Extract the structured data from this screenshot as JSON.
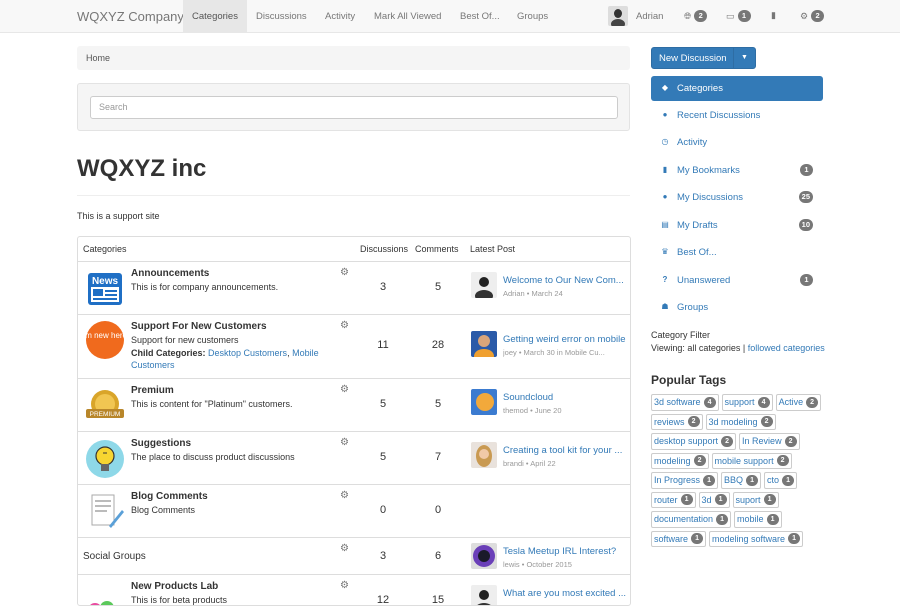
{
  "brand": "WQXYZ Company",
  "nav": [
    "Categories",
    "Discussions",
    "Activity",
    "Mark All Viewed",
    "Best Of...",
    "Groups"
  ],
  "user": {
    "name": "Adrian"
  },
  "top_icons": [
    {
      "icon": "globe-icon",
      "badge": "2"
    },
    {
      "icon": "inbox-icon",
      "badge": "1"
    },
    {
      "icon": "bookmark-icon",
      "badge": ""
    },
    {
      "icon": "gear-icon",
      "badge": "2"
    }
  ],
  "breadcrumb": "Home",
  "search": {
    "placeholder": "Search"
  },
  "page_title": "WQXYZ inc",
  "page_desc": "This is a support site",
  "table_headers": {
    "categories": "Categories",
    "discussions": "Discussions",
    "comments": "Comments",
    "latest": "Latest Post"
  },
  "rows": [
    {
      "name": "Announcements",
      "desc": "This is for company announcements.",
      "discussions": "3",
      "comments": "5",
      "latest_title": "Welcome to Our New Com...",
      "latest_meta": "Adrian • March 24"
    },
    {
      "name": "Support For New Customers",
      "desc": "Support for new customers",
      "child_label": "Child Categories:",
      "child1": "Desktop Customers",
      "child2": "Mobile Customers",
      "discussions": "11",
      "comments": "28",
      "latest_title": "Getting weird error on mobile",
      "latest_meta": "joey • March 30 in Mobile Cu..."
    },
    {
      "name": "Premium",
      "desc": "This is content for \"Platinum\" customers.",
      "discussions": "5",
      "comments": "5",
      "latest_title": "Soundcloud",
      "latest_meta": "themod • June 20"
    },
    {
      "name": "Suggestions",
      "desc": "The place to discuss product discussions",
      "discussions": "5",
      "comments": "7",
      "latest_title": "Creating a tool kit for your ...",
      "latest_meta": "brandi • April 22"
    },
    {
      "name": "Blog Comments",
      "desc": "Blog Comments",
      "discussions": "0",
      "comments": "0"
    },
    {
      "name": "Social Groups",
      "discussions": "3",
      "comments": "6",
      "latest_title": "Tesla Meetup IRL Interest?",
      "latest_meta": "lewis • October 2015"
    },
    {
      "name": "New Products Lab",
      "desc": "This is for beta products",
      "discussions": "12",
      "comments": "15",
      "latest_title": "What are you most excited ..."
    }
  ],
  "icon_labels": {
    "news": "News",
    "im_new": "Im new here",
    "premium": "PREMIUM"
  },
  "new_discussion": "New Discussion",
  "sidebar": [
    {
      "label": "Categories",
      "icon": "tag-icon",
      "badge": ""
    },
    {
      "label": "Recent Discussions",
      "icon": "chat-icon",
      "badge": ""
    },
    {
      "label": "Activity",
      "icon": "clock-icon",
      "badge": ""
    },
    {
      "label": "My Bookmarks",
      "icon": "bookmark-icon",
      "badge": "1"
    },
    {
      "label": "My Discussions",
      "icon": "chat-icon",
      "badge": "25"
    },
    {
      "label": "My Drafts",
      "icon": "document-icon",
      "badge": "10"
    },
    {
      "label": "Best Of...",
      "icon": "trophy-icon",
      "badge": ""
    },
    {
      "label": "Unanswered",
      "icon": "question-icon",
      "badge": "1"
    },
    {
      "label": "Groups",
      "icon": "users-icon",
      "badge": ""
    }
  ],
  "filter": {
    "title": "Category Filter",
    "viewing": "Viewing: all categories |",
    "link": "followed categories"
  },
  "popular_tags_title": "Popular Tags",
  "tags": [
    {
      "name": "3d software",
      "count": "4"
    },
    {
      "name": "support",
      "count": "4"
    },
    {
      "name": "Active",
      "count": "2"
    },
    {
      "name": "reviews",
      "count": "2"
    },
    {
      "name": "3d modeling",
      "count": "2"
    },
    {
      "name": "desktop support",
      "count": "2"
    },
    {
      "name": "In Review",
      "count": "2"
    },
    {
      "name": "modeling",
      "count": "2"
    },
    {
      "name": "mobile support",
      "count": "2"
    },
    {
      "name": "In Progress",
      "count": "1"
    },
    {
      "name": "BBQ",
      "count": "1"
    },
    {
      "name": "cto",
      "count": "1"
    },
    {
      "name": "router",
      "count": "1"
    },
    {
      "name": "3d",
      "count": "1"
    },
    {
      "name": "suport",
      "count": "1"
    },
    {
      "name": "documentation",
      "count": "1"
    },
    {
      "name": "mobile",
      "count": "1"
    },
    {
      "name": "software",
      "count": "1"
    },
    {
      "name": "modeling software",
      "count": "1"
    }
  ],
  "colors": {
    "accent": "#337ab7",
    "badge": "#777777"
  }
}
